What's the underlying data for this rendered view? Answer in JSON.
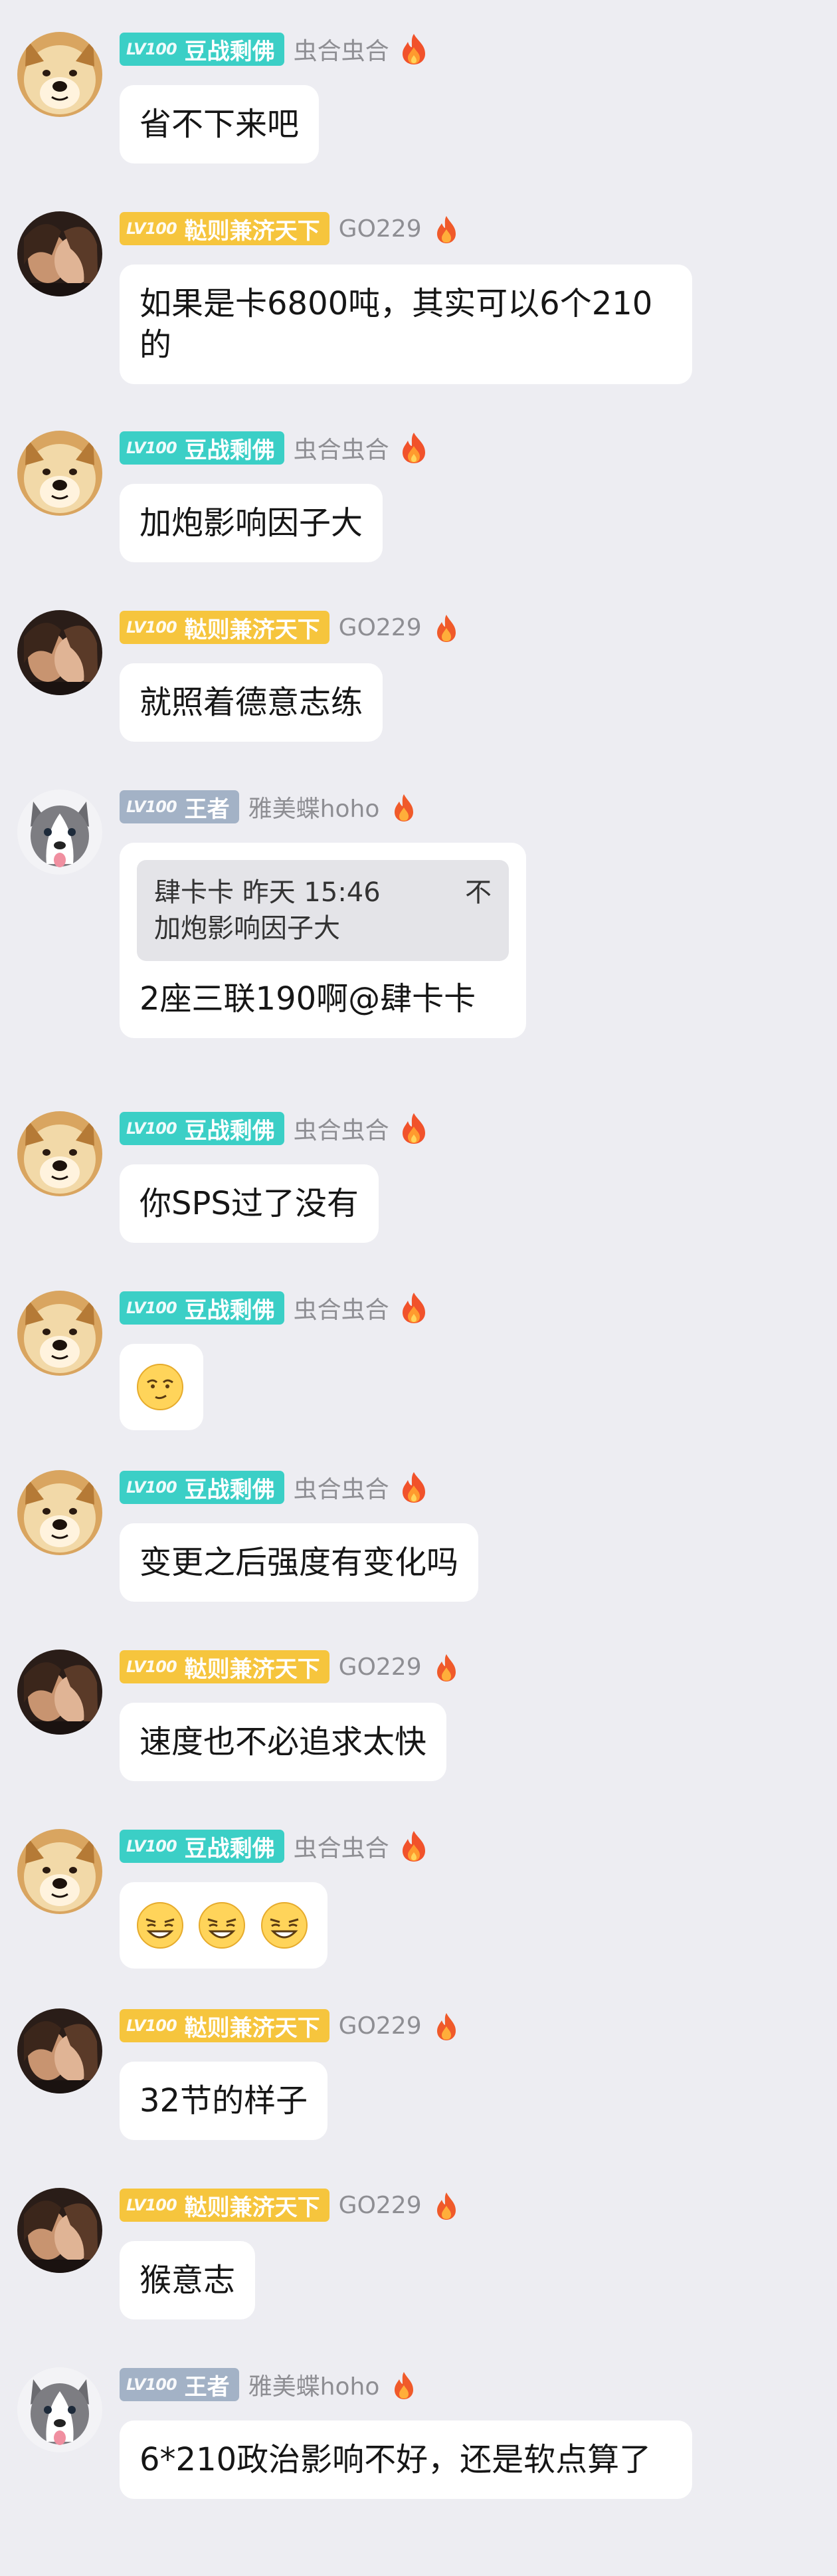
{
  "users": {
    "doge": {
      "level": "LV100",
      "title": "豆战剩佛",
      "nickname": "虫合虫合"
    },
    "couple": {
      "level": "LV100",
      "title": "鞑则兼济天下",
      "nickname": "GO229"
    },
    "husky": {
      "level": "LV100",
      "title": "王者",
      "nickname": "雅美蝶hoho"
    }
  },
  "messages": [
    {
      "text": "省不下来吧"
    },
    {
      "text": "如果是卡6800吨，其实可以6个210的"
    },
    {
      "text": "加炮影响因子大"
    },
    {
      "text": "就照着德意志练"
    },
    {
      "quote_author": "肆卡卡",
      "quote_time": "昨天 15:46",
      "quote_flag": "不",
      "quote_text": "加炮影响因子大",
      "text": "2座三联190啊@肆卡卡"
    },
    {
      "text": "你SPS过了没有"
    },
    {
      "emojis": [
        "smirk-emoji"
      ]
    },
    {
      "text": "变更之后强度有变化吗"
    },
    {
      "text": "速度也不必追求太快"
    },
    {
      "emojis": [
        "grin-emoji",
        "grin-emoji",
        "grin-emoji"
      ]
    },
    {
      "text": "32节的样子"
    },
    {
      "text": "猴意志"
    },
    {
      "text": "6*210政治影响不好，还是软点算了"
    }
  ]
}
